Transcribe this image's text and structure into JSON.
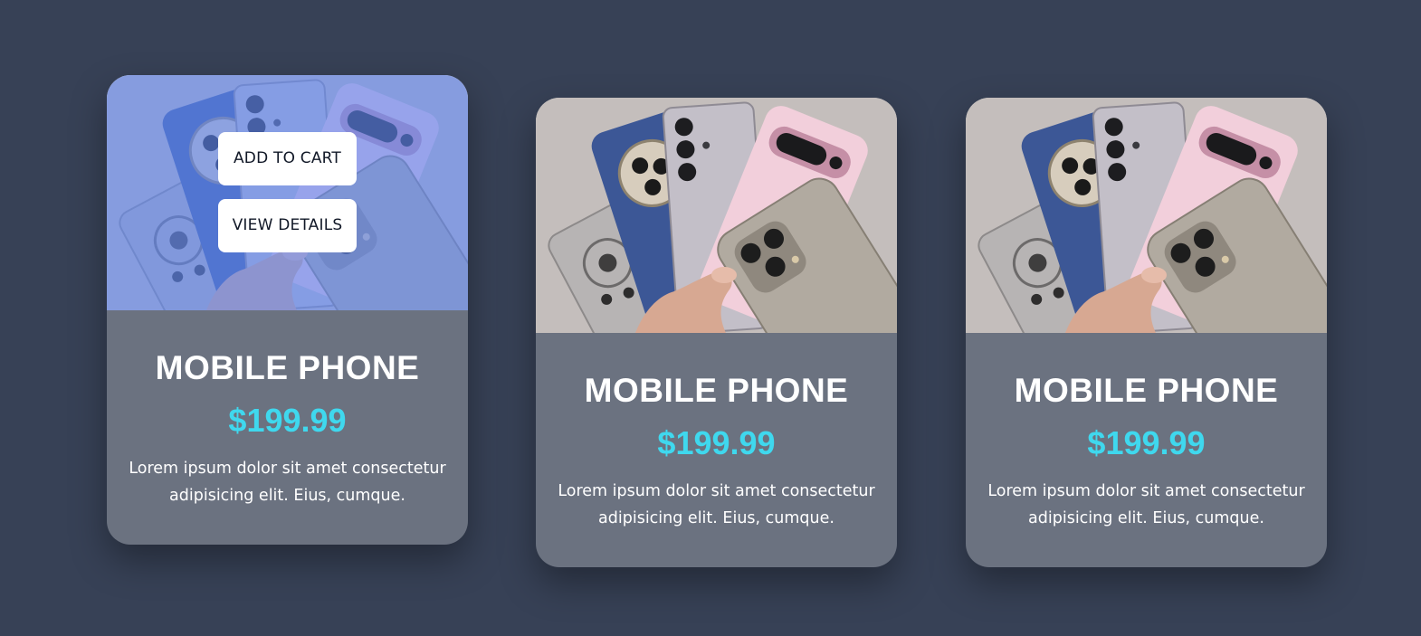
{
  "cards": [
    {
      "title": "MOBILE PHONE",
      "price": "$199.99",
      "description": "Lorem ipsum dolor sit amet consectetur adipisicing elit. Eius, cumque.",
      "hovered": true,
      "actions": {
        "add_to_cart": "ADD TO CART",
        "view_details": "VIEW DETAILS"
      }
    },
    {
      "title": "MOBILE PHONE",
      "price": "$199.99",
      "description": "Lorem ipsum dolor sit amet consectetur adipisicing elit. Eius, cumque.",
      "hovered": false
    },
    {
      "title": "MOBILE PHONE",
      "price": "$199.99",
      "description": "Lorem ipsum dolor sit amet consectetur adipisicing elit. Eius, cumque."
    }
  ],
  "colors": {
    "page_background": "#374156",
    "card_background": "#6b7280",
    "price": "#3fd8ee",
    "hover_overlay": "#5f87f5"
  }
}
